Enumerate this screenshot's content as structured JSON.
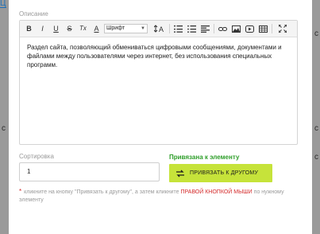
{
  "backdrop": {
    "tab_fragment": "Ц",
    "side_chars": [
      "с",
      "с",
      "с",
      "с"
    ]
  },
  "modal": {
    "description_label": "Описание",
    "editor": {
      "toolbar": {
        "bold": "B",
        "italic": "I",
        "underline": "U",
        "strike": "S",
        "clear_format": "Tx",
        "text_color": "A",
        "font_select": "Шрифт",
        "icons": [
          "bold-icon",
          "italic-icon",
          "underline-icon",
          "strikethrough-icon",
          "clear-format-icon",
          "text-color-icon",
          "font-size-icon",
          "ordered-list-icon",
          "unordered-list-icon",
          "align-icon",
          "link-icon",
          "image-icon",
          "video-icon",
          "table-icon",
          "fullscreen-icon"
        ]
      },
      "content": "Раздел сайта, позволяющий обмениваться цифровыми сообщениями, документами и файлами между пользователями через интернет, без использования специальных программ."
    },
    "sort_label": "Сортировка",
    "sort_value": "1",
    "bound_label": "Привязана к элементу",
    "bind_button": "ПРИВЯЗАТЬ К ДРУГОМУ",
    "note": {
      "star": "*",
      "part1": "кликните на кнопку \"Привязать к другому\", а затем кликните",
      "red_part": "ПРАВОЙ КНОПКОЙ МЫШИ",
      "part2": "по нужному элементу"
    },
    "colors": {
      "accent_green": "#c6e33a",
      "label_green": "#2e9e2a",
      "warning_red": "#d42a2a"
    }
  }
}
